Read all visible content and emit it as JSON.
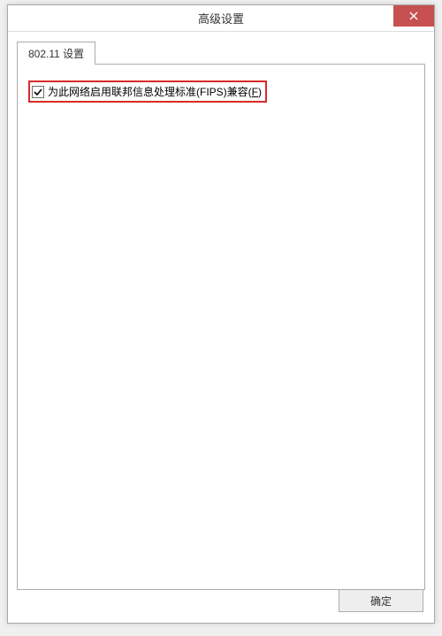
{
  "window": {
    "title": "高级设置"
  },
  "tabs": {
    "items": [
      {
        "label": "802.11 设置"
      }
    ]
  },
  "panel": {
    "fips_checkbox": {
      "checked": true,
      "label_pre": "为此网络启用联邦信息处理标准(FIPS)兼容(",
      "label_key": "F",
      "label_post": ")"
    }
  },
  "buttons": {
    "ok": "确定"
  }
}
